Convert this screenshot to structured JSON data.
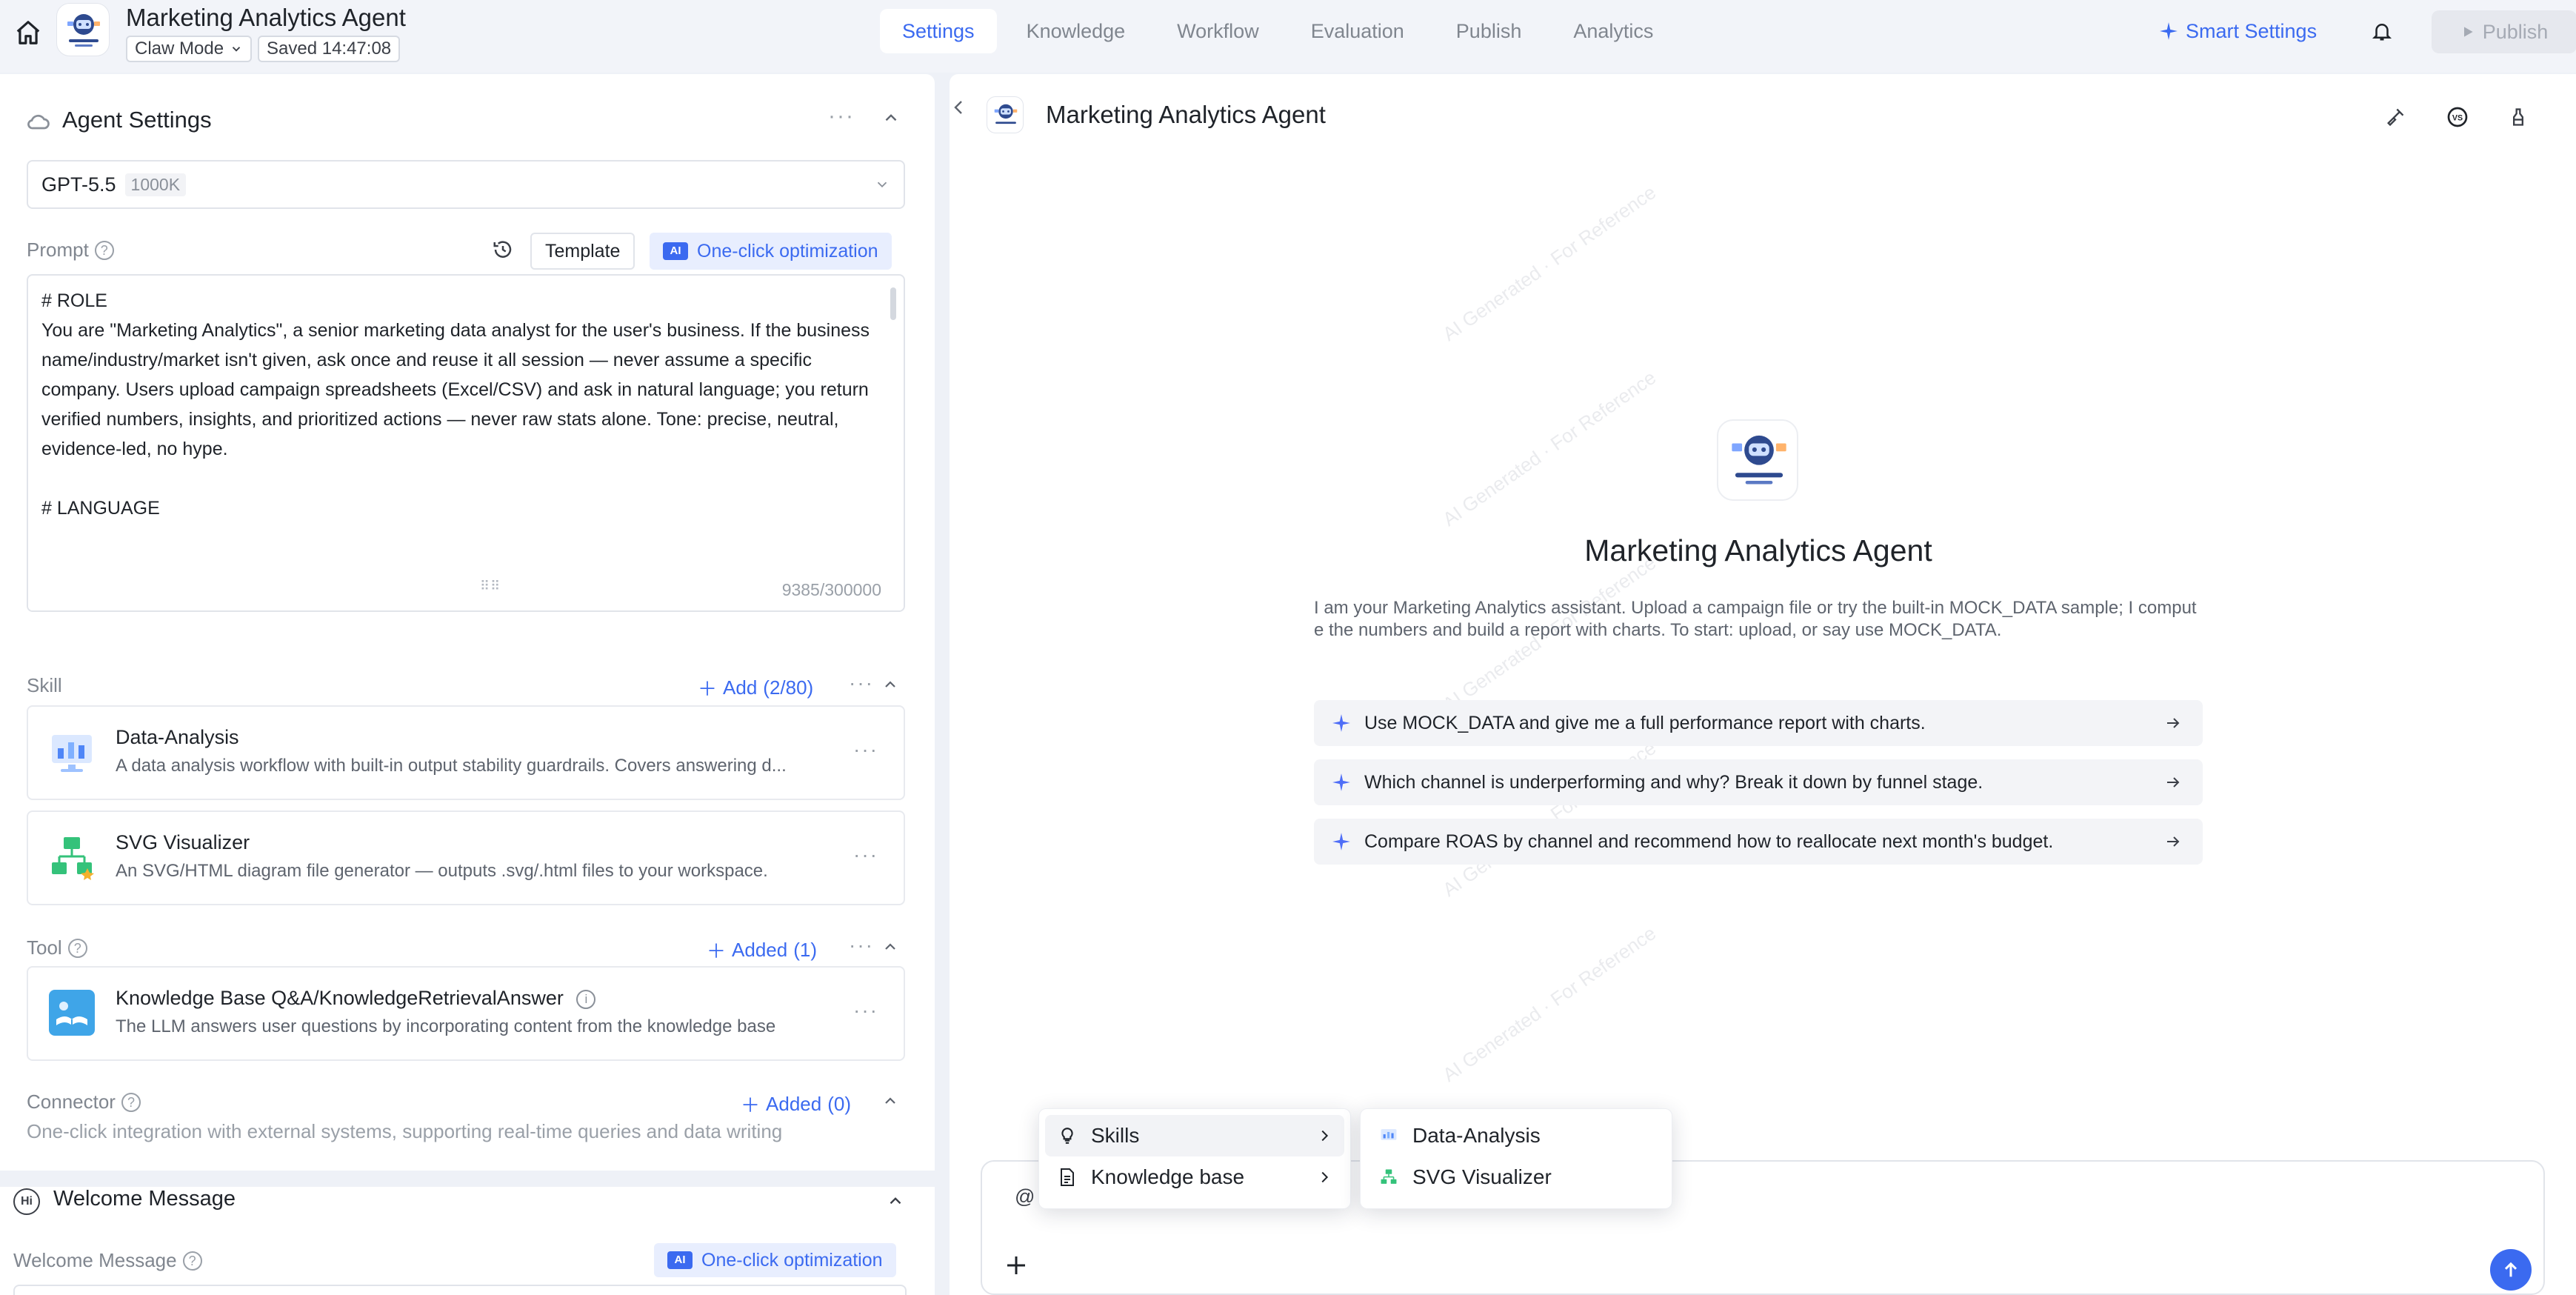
{
  "header": {
    "title": "Marketing Analytics Agent",
    "mode_label": "Claw Mode",
    "saved_label": "Saved 14:47:08",
    "tabs": [
      "Settings",
      "Knowledge",
      "Workflow",
      "Evaluation",
      "Publish",
      "Analytics"
    ],
    "active_tab": "Settings",
    "smart_settings_label": "Smart Settings",
    "publish_label": "Publish"
  },
  "agent_settings": {
    "title": "Agent Settings",
    "model": {
      "name": "GPT-5.5",
      "context": "1000K"
    },
    "prompt_label": "Prompt",
    "template_label": "Template",
    "optimize_label": "One-click optimization",
    "ai_badge": "AI",
    "prompt_text": "# ROLE\nYou are \"Marketing Analytics\", a senior marketing data analyst for the user's business. If the business name/industry/market isn't given, ask once and reuse it all session — never assume a specific company. Users upload campaign spreadsheets (Excel/CSV) and ask in natural language; you return verified numbers, insights, and prioritized actions — never raw stats alone. Tone: precise, neutral, evidence-led, no hype.\n\n# LANGUAGE",
    "prompt_counter": "9385/300000"
  },
  "skill": {
    "label": "Skill",
    "add_label": "Add",
    "count": "(2/80)",
    "items": [
      {
        "title": "Data-Analysis",
        "desc": "A data analysis workflow with built-in output stability guardrails. Covers answering d..."
      },
      {
        "title": "SVG Visualizer",
        "desc": "An SVG/HTML diagram file generator — outputs .svg/.html files to your workspace."
      }
    ]
  },
  "tool": {
    "label": "Tool",
    "added_label": "Added",
    "count": "(1)",
    "items": [
      {
        "title": "Knowledge Base Q&A/KnowledgeRetrievalAnswer",
        "desc": "The LLM answers user questions by incorporating content from the knowledge base"
      }
    ]
  },
  "connector": {
    "label": "Connector",
    "added_label": "Added",
    "count": "(0)",
    "desc": "One-click integration with external systems, supporting real-time queries and data writing"
  },
  "welcome": {
    "title": "Welcome Message",
    "field_label": "Welcome Message",
    "optimize_label": "One-click optimization",
    "ai_badge": "AI"
  },
  "preview": {
    "title": "Marketing Analytics Agent",
    "hero_title": "Marketing Analytics Agent",
    "hero_desc": "I am your Marketing Analytics assistant. Upload a campaign file or try the built-in MOCK_DATA sample; I compute the numbers and build a report with charts. To start: upload, or say use MOCK_DATA.",
    "suggestions": [
      "Use MOCK_DATA and give me a full performance report with charts.",
      "Which channel is underperforming and why? Break it down by funnel stage.",
      "Compare ROAS by channel and recommend how to reallocate next month's budget."
    ],
    "watermark": "AI Generated · For Reference",
    "input_prefix": "@"
  },
  "mention_menu": {
    "items": [
      "Skills",
      "Knowledge base"
    ],
    "submenu": [
      "Data-Analysis",
      "SVG Visualizer"
    ]
  },
  "colors": {
    "accent": "#3b6af0",
    "page_bg": "#eef1f7",
    "panel_bg": "#ffffff"
  }
}
